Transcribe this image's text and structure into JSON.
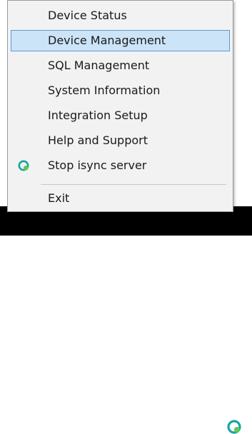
{
  "menu": {
    "items": [
      {
        "label": "Device Status"
      },
      {
        "label": "Device Management"
      },
      {
        "label": "SQL Management"
      },
      {
        "label": "System Information"
      },
      {
        "label": "Integration Setup"
      },
      {
        "label": "Help and Support"
      },
      {
        "label": "Stop isync server",
        "icon": "isync-server-icon"
      }
    ],
    "exit_label": "Exit",
    "highlighted_index": 1
  },
  "taskbar": {
    "icons": [
      "chevron-up-icon",
      "isync-tray-icon"
    ]
  },
  "colors": {
    "menu_background": "#f2f2f2",
    "highlight_fill": "#cce4f7",
    "highlight_border": "#5a9bd5",
    "icon_teal": "#1aa3a3",
    "icon_green": "#5cc85a",
    "taskbar": "#000000"
  }
}
